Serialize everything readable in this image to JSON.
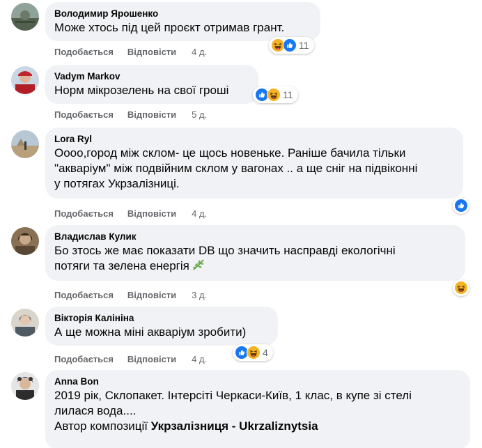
{
  "comments": [
    {
      "author": "Володимир Ярошенко",
      "text": "Може хтось під цей проєкт отримав грант.",
      "like_label": "Подобається",
      "reply_label": "Відповісти",
      "time": "4 д.",
      "reactions": [
        "haha",
        "like"
      ],
      "reaction_count": "11"
    },
    {
      "author": "Vadym Markov",
      "text": "Норм мікрозелень на свої гроші",
      "like_label": "Подобається",
      "reply_label": "Відповісти",
      "time": "5 д.",
      "reactions": [
        "like",
        "haha"
      ],
      "reaction_count": "11"
    },
    {
      "author": "Lora Ryl",
      "text_lines": [
        "Оооо,город між склом- це щось новеньке. Раніше бачила тільки",
        "\"акваріум\" між подвійним склом у вагонах .. а ще сніг на підвіконні",
        "у потягах Укрзалізниці."
      ],
      "like_label": "Подобається",
      "reply_label": "Відповісти",
      "time": "4 д.",
      "reactions": [
        "like"
      ]
    },
    {
      "author": "Владислав Кулик",
      "text_lines": [
        "Бо зтось же має показати DB що значить насправді екологічні",
        "потяги та зелена енергія"
      ],
      "like_label": "Подобається",
      "reply_label": "Відповісти",
      "time": "3 д.",
      "reactions": [
        "haha"
      ]
    },
    {
      "author": "Вікторія Калініна",
      "text": "А ще можна міні акваріум зробити)",
      "like_label": "Подобається",
      "reply_label": "Відповісти",
      "time": "4 д.",
      "reactions": [
        "like",
        "haha"
      ],
      "reaction_count": "4"
    },
    {
      "author": "Anna Bon",
      "text_lines": [
        "2019 рік, Склопакет. Інтерсіті Черкаси-Київ, 1 клас, в купе зі стелі",
        "лилася вода...."
      ],
      "composer_prefix": "Автор композиції",
      "composer_name": "Укрзалізниця - Ukrzaliznytsia"
    }
  ],
  "colors": {
    "bubble_bg": "#f0f2f5",
    "action_text": "#65676b",
    "like_blue": "#1877f2",
    "haha_yellow": "#f7b125"
  }
}
